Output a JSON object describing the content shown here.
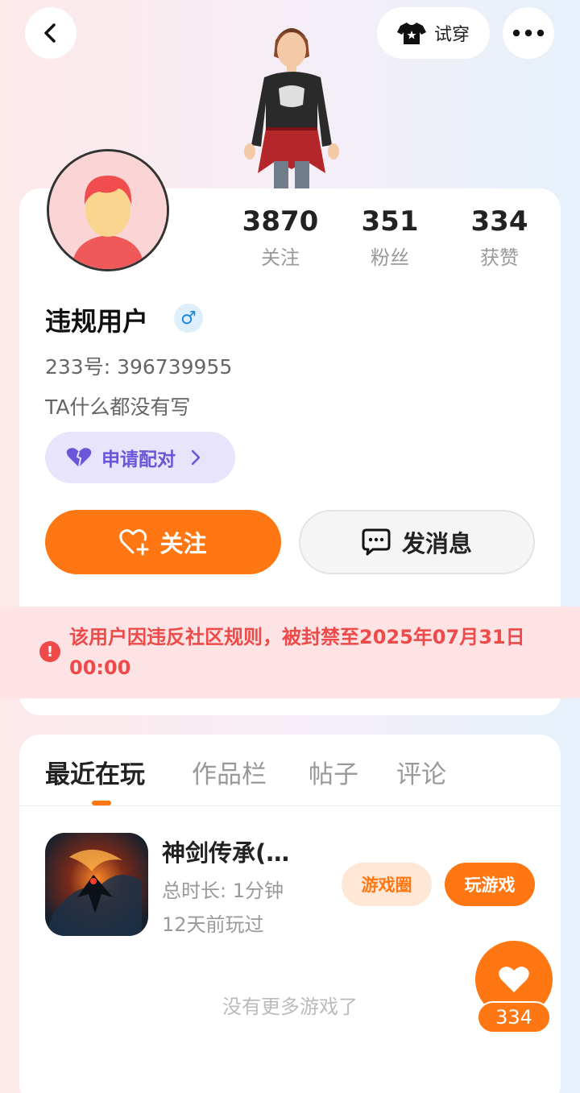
{
  "header": {
    "tryon_label": "试穿"
  },
  "stats": [
    {
      "value": "3870",
      "label": "关注"
    },
    {
      "value": "351",
      "label": "粉丝"
    },
    {
      "value": "334",
      "label": "获赞"
    }
  ],
  "profile": {
    "username": "违规用户",
    "gender_symbol": "♂",
    "uid_line": "233号: 396739955",
    "bio": "TA什么都没有写",
    "pair_label": "申请配对",
    "follow_label": "关注",
    "message_label": "发消息"
  },
  "ban": {
    "icon": "!",
    "text": "该用户因违反社区规则，被封禁至2025年07月31日 00:00"
  },
  "tabs": [
    "最近在玩",
    "作品栏",
    "帖子",
    "评论"
  ],
  "game": {
    "title": "神剑传承(…",
    "duration": "总时长: 1分钟",
    "last_played": "12天前玩过",
    "circle_label": "游戏圈",
    "play_label": "玩游戏"
  },
  "no_more_text": "没有更多游戏了",
  "like_fab": {
    "count": "334"
  },
  "colors": {
    "accent": "#ff7712",
    "ban": "#ee4a4a",
    "pair": "#6b55d8"
  }
}
